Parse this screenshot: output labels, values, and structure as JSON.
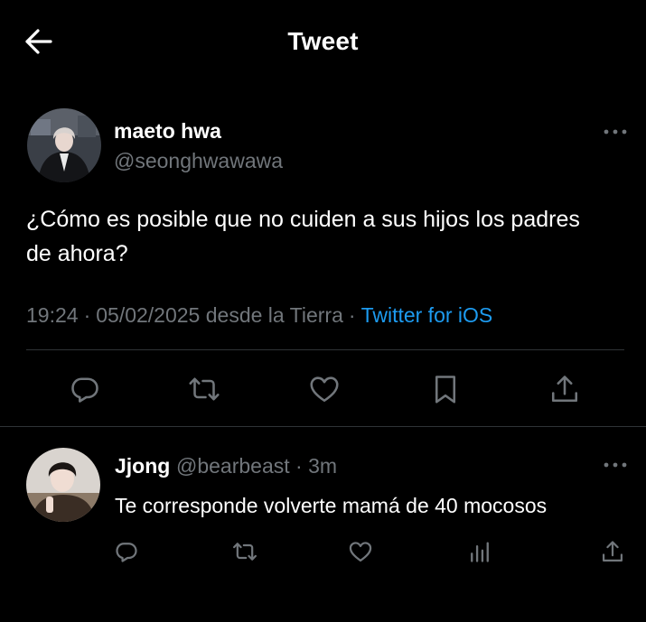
{
  "header": {
    "title": "Tweet",
    "back_icon": "arrow-left-icon"
  },
  "tweet": {
    "author_name": "maeto hwa",
    "author_handle": "@seonghwawawa",
    "text": "¿Cómo es posible que no cuiden a sus hijos los padres de ahora?",
    "time": "19:24",
    "separator": "·",
    "date": "05/02/2025 desde la Tierra",
    "source": "Twitter for iOS",
    "actions": [
      "reply-icon",
      "retweet-icon",
      "like-icon",
      "bookmark-icon",
      "share-icon"
    ]
  },
  "reply": {
    "author_name": "Jjong",
    "author_handle": "@bearbeast",
    "separator": "·",
    "time_ago": "3m",
    "text": "Te corresponde volverte mamá de 40 mocosos",
    "actions": [
      "reply-icon",
      "retweet-icon",
      "like-icon",
      "analytics-icon",
      "share-icon"
    ]
  },
  "colors": {
    "background": "#000000",
    "primary_text": "#ffffff",
    "secondary_text": "#71767b",
    "link": "#1d9bf0",
    "divider": "#2f3336",
    "icon": "#71767b"
  }
}
